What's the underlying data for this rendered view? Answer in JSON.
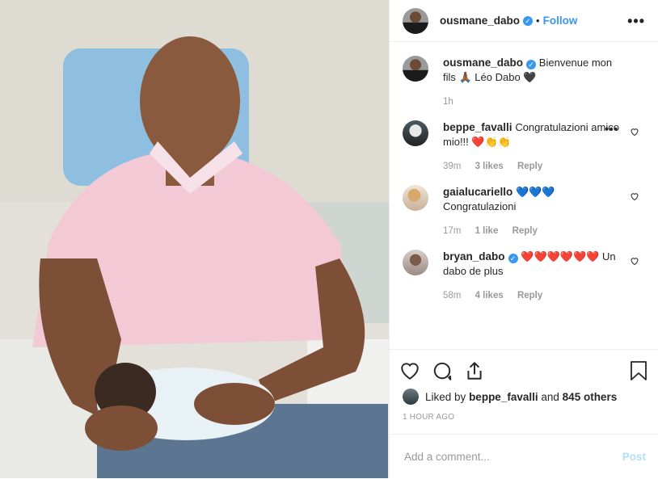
{
  "header": {
    "username": "ousmane_dabo",
    "follow_label": "Follow",
    "more_label": "•••"
  },
  "caption": {
    "username": "ousmane_dabo",
    "text": "Bienvenue mon fils 🙏🏾 Léo Dabo 🖤",
    "time": "1h"
  },
  "comments": [
    {
      "username": "beppe_favalli",
      "text": "Congratulazioni amico mio!!! ❤️👏👏",
      "time": "39m",
      "likes": "3 likes",
      "reply": "Reply"
    },
    {
      "username": "gaialucariello",
      "text": "💙💙💙 Congratulazioni",
      "time": "17m",
      "likes": "1 like",
      "reply": "Reply"
    },
    {
      "username": "bryan_dabo",
      "text": "❤️❤️❤️❤️❤️❤️ Un dabo de plus",
      "time": "58m",
      "likes": "4 likes",
      "reply": "Reply"
    }
  ],
  "likes": {
    "prefix": "Liked by",
    "user": "beppe_favalli",
    "connector": "and",
    "others": "845 others"
  },
  "timestamp": "1 HOUR AGO",
  "add_comment": {
    "placeholder": "Add a comment...",
    "post_label": "Post"
  },
  "icons": [
    "heart-icon",
    "comment-icon",
    "share-icon",
    "bookmark-icon"
  ],
  "colors": {
    "accent": "#3897f0",
    "post_disabled": "#b2dffc",
    "muted": "#999999"
  }
}
